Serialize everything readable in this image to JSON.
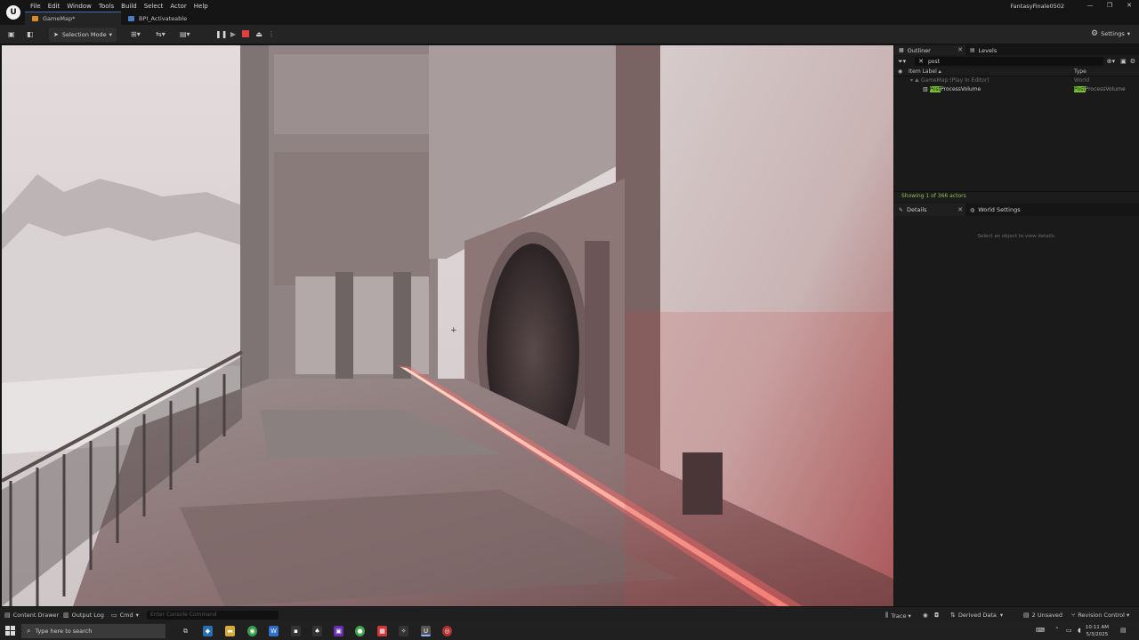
{
  "titlebar": {
    "menus": [
      "File",
      "Edit",
      "Window",
      "Tools",
      "Build",
      "Select",
      "Actor",
      "Help"
    ],
    "tabs": [
      {
        "label": "GameMap*",
        "active": true,
        "icon": "map-icon"
      },
      {
        "label": "BPI_Activateable",
        "active": false,
        "icon": "blueprint-interface-icon"
      }
    ],
    "project_name": "FantasyFinale0502",
    "window_controls": [
      "—",
      "❐",
      "✕"
    ]
  },
  "toolbar": {
    "selection_mode": "Selection Mode",
    "settings": "Settings",
    "play_state": "playing",
    "accent_stop": "#e04040",
    "accent_pause": "#d9d9d9"
  },
  "outliner": {
    "tab_label": "Outliner",
    "levels_tab": "Levels",
    "search_value": "post",
    "header_label": "Item Label",
    "header_type": "Type",
    "rows": [
      {
        "label": "GameMap (Play In Editor)",
        "type": "World",
        "dim": true
      },
      {
        "label_highlight": "Post",
        "label_rest": "ProcessVolume",
        "type_highlight": "Post",
        "type_rest": "ProcessVolume"
      }
    ],
    "status": "Showing 1 of 366 actors"
  },
  "details": {
    "tab_label": "Details",
    "world_settings_tab": "World Settings",
    "empty_message": "Select an object to view details."
  },
  "statusbar": {
    "content_drawer": "Content Drawer",
    "output_log": "Output Log",
    "cmd": "Cmd",
    "console_placeholder": "Enter Console Command",
    "trace": "Trace",
    "derived_data": "Derived Data",
    "unsaved": "2 Unsaved",
    "revision_control": "Revision Control"
  },
  "taskbar": {
    "search_placeholder": "Type here to search",
    "time": "10:11 AM",
    "date": "5/3/2025"
  }
}
